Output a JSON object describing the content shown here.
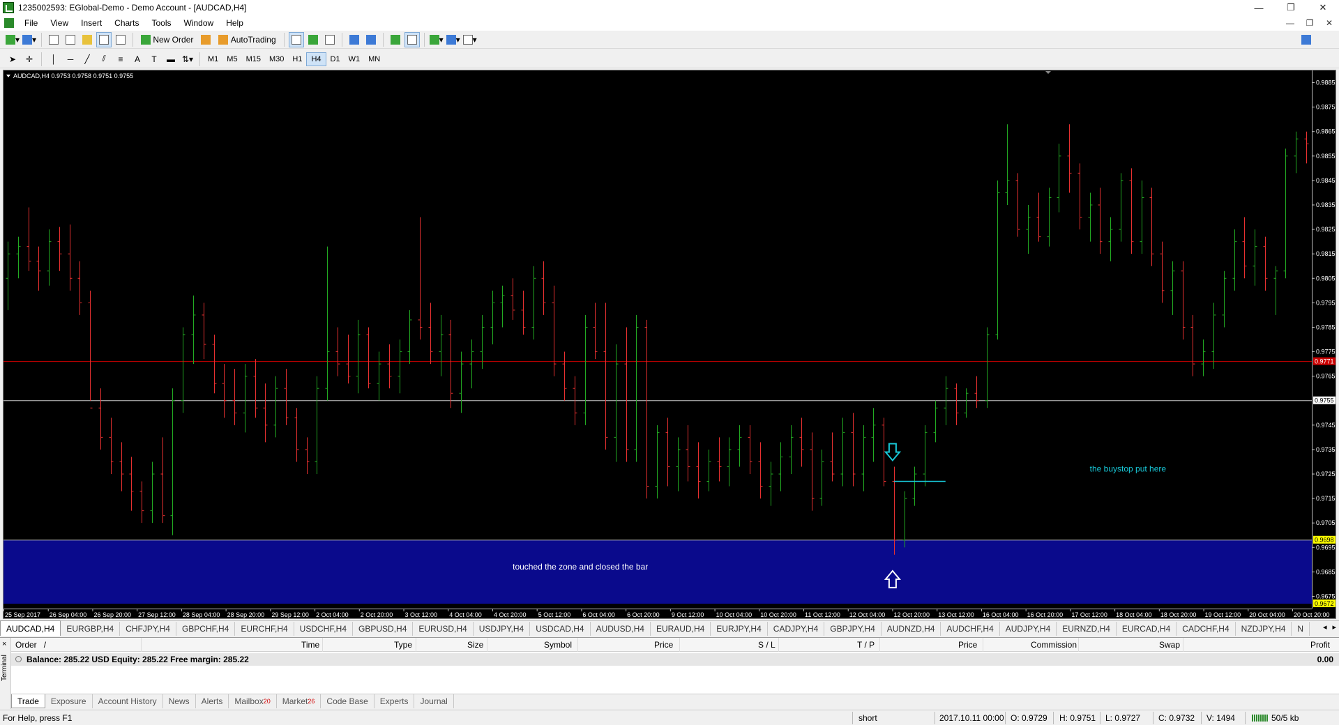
{
  "window": {
    "title": "1235002593: EGlobal-Demo - Demo Account - [AUDCAD,H4]",
    "controls": [
      "—",
      "❐",
      "✕"
    ]
  },
  "menu": {
    "items": [
      "File",
      "View",
      "Insert",
      "Charts",
      "Tools",
      "Window",
      "Help"
    ],
    "right_controls": [
      "—",
      "❐",
      "✕"
    ]
  },
  "toolbar": {
    "new_order_label": "New Order",
    "autotrading_label": "AutoTrading",
    "timeframes": [
      "M1",
      "M5",
      "M15",
      "M30",
      "H1",
      "H4",
      "D1",
      "W1",
      "MN"
    ],
    "active_timeframe": "H4"
  },
  "chart": {
    "info": "AUDCAD,H4  0.9753 0.9758 0.9751 0.9755",
    "colors": {
      "background": "#000000",
      "bull": "#22aa22",
      "bear": "#e83030",
      "zone": "#0a0a8c",
      "red_line": "#cc0000",
      "white_line": "#cccccc",
      "annotation": "#18c8d8"
    },
    "price_levels": {
      "red_line": 0.9771,
      "red_line_label": "0.9771",
      "bid_line": 0.9755,
      "bid_label": "0.9755",
      "zone_top": 0.9698,
      "zone_top_label": "0.9698",
      "zone_bottom": 0.9672,
      "zone_bottom_label": "0.9672"
    },
    "annotations": {
      "buystop_text": "the buystop put here",
      "zone_text": "touched the zone and closed the bar"
    }
  },
  "chart_data": {
    "type": "candlestick",
    "symbol": "AUDCAD",
    "timeframe": "H4",
    "y_ticks": [
      "0.9885",
      "0.9875",
      "0.9865",
      "0.9855",
      "0.9845",
      "0.9835",
      "0.9825",
      "0.9815",
      "0.9805",
      "0.9795",
      "0.9785",
      "0.9775",
      "0.9765",
      "0.9745",
      "0.9735",
      "0.9725",
      "0.9715",
      "0.9705",
      "0.9695",
      "0.9685",
      "0.9675"
    ],
    "ylim": [
      0.967,
      0.989
    ],
    "x_ticks": [
      "25 Sep 2017",
      "26 Sep 04:00",
      "26 Sep 20:00",
      "27 Sep 12:00",
      "28 Sep 04:00",
      "28 Sep 20:00",
      "29 Sep 12:00",
      "2 Oct 04:00",
      "2 Oct 20:00",
      "3 Oct 12:00",
      "4 Oct 04:00",
      "4 Oct 20:00",
      "5 Oct 12:00",
      "6 Oct 04:00",
      "6 Oct 20:00",
      "9 Oct 12:00",
      "10 Oct 04:00",
      "10 Oct 20:00",
      "11 Oct 12:00",
      "12 Oct 04:00",
      "12 Oct 20:00",
      "13 Oct 12:00",
      "16 Oct 04:00",
      "16 Oct 20:00",
      "17 Oct 12:00",
      "18 Oct 04:00",
      "18 Oct 20:00",
      "19 Oct 12:00",
      "20 Oct 04:00",
      "20 Oct 20:00"
    ],
    "bars": [
      [
        0.9805,
        0.982,
        0.9792,
        0.9815
      ],
      [
        0.9815,
        0.9822,
        0.9805,
        0.9818
      ],
      [
        0.9818,
        0.9834,
        0.9808,
        0.9812
      ],
      [
        0.9812,
        0.9818,
        0.98,
        0.9808
      ],
      [
        0.9808,
        0.9825,
        0.9802,
        0.982
      ],
      [
        0.982,
        0.9826,
        0.9808,
        0.9815
      ],
      [
        0.9815,
        0.9827,
        0.98,
        0.9805
      ],
      [
        0.9805,
        0.9812,
        0.979,
        0.9795
      ],
      [
        0.9795,
        0.98,
        0.9755,
        0.9752
      ],
      [
        0.9752,
        0.976,
        0.9735,
        0.974
      ],
      [
        0.974,
        0.9748,
        0.9725,
        0.973
      ],
      [
        0.973,
        0.9738,
        0.9718,
        0.9725
      ],
      [
        0.9725,
        0.9732,
        0.971,
        0.9718
      ],
      [
        0.9718,
        0.9722,
        0.9705,
        0.971
      ],
      [
        0.971,
        0.973,
        0.9705,
        0.9725
      ],
      [
        0.9725,
        0.974,
        0.9705,
        0.9708
      ],
      [
        0.9708,
        0.976,
        0.97,
        0.9755
      ],
      [
        0.9755,
        0.9785,
        0.975,
        0.9782
      ],
      [
        0.9782,
        0.9798,
        0.977,
        0.979
      ],
      [
        0.979,
        0.9795,
        0.9772,
        0.9778
      ],
      [
        0.9778,
        0.9782,
        0.9758,
        0.9762
      ],
      [
        0.9762,
        0.977,
        0.9748,
        0.9755
      ],
      [
        0.9755,
        0.9768,
        0.9745,
        0.975
      ],
      [
        0.975,
        0.977,
        0.9742,
        0.9765
      ],
      [
        0.9765,
        0.9772,
        0.9748,
        0.9752
      ],
      [
        0.9752,
        0.9762,
        0.9738,
        0.9745
      ],
      [
        0.9745,
        0.9765,
        0.974,
        0.976
      ],
      [
        0.976,
        0.9768,
        0.9745,
        0.9748
      ],
      [
        0.9748,
        0.9752,
        0.973,
        0.9735
      ],
      [
        0.9735,
        0.974,
        0.9725,
        0.973
      ],
      [
        0.973,
        0.9765,
        0.9725,
        0.976
      ],
      [
        0.976,
        0.9818,
        0.9755,
        0.9775
      ],
      [
        0.9775,
        0.9785,
        0.9765,
        0.977
      ],
      [
        0.977,
        0.9782,
        0.9762,
        0.9765
      ],
      [
        0.9765,
        0.9788,
        0.9758,
        0.9782
      ],
      [
        0.9782,
        0.9785,
        0.976,
        0.9762
      ],
      [
        0.9762,
        0.9775,
        0.9755,
        0.977
      ],
      [
        0.977,
        0.9778,
        0.976,
        0.9765
      ],
      [
        0.9765,
        0.978,
        0.9758,
        0.9775
      ],
      [
        0.9775,
        0.9792,
        0.977,
        0.9788
      ],
      [
        0.9788,
        0.983,
        0.978,
        0.9785
      ],
      [
        0.9785,
        0.9795,
        0.977,
        0.9775
      ],
      [
        0.9775,
        0.979,
        0.9765,
        0.9782
      ],
      [
        0.9782,
        0.9788,
        0.9752,
        0.9758
      ],
      [
        0.9758,
        0.9775,
        0.975,
        0.977
      ],
      [
        0.977,
        0.978,
        0.976,
        0.9775
      ],
      [
        0.9775,
        0.979,
        0.9768,
        0.9785
      ],
      [
        0.9785,
        0.98,
        0.9778,
        0.9795
      ],
      [
        0.9795,
        0.9802,
        0.9785,
        0.9798
      ],
      [
        0.9798,
        0.9805,
        0.9788,
        0.9792
      ],
      [
        0.9792,
        0.98,
        0.9782,
        0.9785
      ],
      [
        0.9785,
        0.981,
        0.978,
        0.9805
      ],
      [
        0.9805,
        0.9812,
        0.979,
        0.9795
      ],
      [
        0.9795,
        0.9802,
        0.9765,
        0.977
      ],
      [
        0.977,
        0.9775,
        0.9755,
        0.976
      ],
      [
        0.976,
        0.9765,
        0.9745,
        0.975
      ],
      [
        0.975,
        0.979,
        0.9745,
        0.9785
      ],
      [
        0.9785,
        0.9795,
        0.9772,
        0.9775
      ],
      [
        0.9775,
        0.9795,
        0.9735,
        0.974
      ],
      [
        0.974,
        0.9778,
        0.973,
        0.977
      ],
      [
        0.977,
        0.9785,
        0.973,
        0.9735
      ],
      [
        0.9735,
        0.979,
        0.973,
        0.9785
      ],
      [
        0.9785,
        0.9788,
        0.9715,
        0.972
      ],
      [
        0.972,
        0.9745,
        0.9715,
        0.9742
      ],
      [
        0.9742,
        0.9748,
        0.972,
        0.9728
      ],
      [
        0.9728,
        0.974,
        0.9718,
        0.9735
      ],
      [
        0.9735,
        0.9745,
        0.9722,
        0.9728
      ],
      [
        0.9728,
        0.9738,
        0.9715,
        0.9722
      ],
      [
        0.9722,
        0.9735,
        0.9718,
        0.973
      ],
      [
        0.973,
        0.974,
        0.9722,
        0.9728
      ],
      [
        0.9728,
        0.974,
        0.972,
        0.9735
      ],
      [
        0.9735,
        0.9745,
        0.9728,
        0.974
      ],
      [
        0.974,
        0.9745,
        0.9725,
        0.973
      ],
      [
        0.973,
        0.9738,
        0.9715,
        0.972
      ],
      [
        0.972,
        0.973,
        0.9712,
        0.9725
      ],
      [
        0.9725,
        0.9738,
        0.9718,
        0.9732
      ],
      [
        0.9732,
        0.9745,
        0.9725,
        0.974
      ],
      [
        0.974,
        0.9748,
        0.9728,
        0.9735
      ],
      [
        0.9735,
        0.9742,
        0.971,
        0.9715
      ],
      [
        0.9715,
        0.9735,
        0.9712,
        0.973
      ],
      [
        0.973,
        0.9742,
        0.9722,
        0.9725
      ],
      [
        0.9725,
        0.9748,
        0.972,
        0.9742
      ],
      [
        0.9742,
        0.975,
        0.972,
        0.9725
      ],
      [
        0.9725,
        0.9745,
        0.9718,
        0.974
      ],
      [
        0.974,
        0.9752,
        0.973,
        0.9745
      ],
      [
        0.9745,
        0.9748,
        0.972,
        0.9722
      ],
      [
        0.9722,
        0.9728,
        0.9692,
        0.9698
      ],
      [
        0.9698,
        0.9718,
        0.9695,
        0.9715
      ],
      [
        0.9715,
        0.9728,
        0.9712,
        0.9725
      ],
      [
        0.9725,
        0.9745,
        0.972,
        0.9742
      ],
      [
        0.9742,
        0.9755,
        0.9738,
        0.9752
      ],
      [
        0.9752,
        0.9765,
        0.9745,
        0.976
      ],
      [
        0.976,
        0.9762,
        0.9745,
        0.975
      ],
      [
        0.975,
        0.976,
        0.9748,
        0.9758
      ],
      [
        0.9758,
        0.9765,
        0.9752,
        0.9755
      ],
      [
        0.9755,
        0.9785,
        0.9752,
        0.9782
      ],
      [
        0.9782,
        0.9845,
        0.978,
        0.984
      ],
      [
        0.984,
        0.9868,
        0.9835,
        0.9845
      ],
      [
        0.9845,
        0.9848,
        0.9822,
        0.9825
      ],
      [
        0.9825,
        0.9835,
        0.9815,
        0.983
      ],
      [
        0.983,
        0.984,
        0.982,
        0.9822
      ],
      [
        0.9822,
        0.9842,
        0.9818,
        0.9838
      ],
      [
        0.9838,
        0.986,
        0.9832,
        0.9855
      ],
      [
        0.9855,
        0.9868,
        0.984,
        0.9848
      ],
      [
        0.9848,
        0.9852,
        0.9825,
        0.983
      ],
      [
        0.983,
        0.984,
        0.982,
        0.9835
      ],
      [
        0.9835,
        0.9842,
        0.9815,
        0.982
      ],
      [
        0.982,
        0.983,
        0.9812,
        0.9825
      ],
      [
        0.9825,
        0.9848,
        0.982,
        0.9845
      ],
      [
        0.9845,
        0.985,
        0.9815,
        0.982
      ],
      [
        0.982,
        0.9845,
        0.9815,
        0.9838
      ],
      [
        0.9838,
        0.9842,
        0.981,
        0.9815
      ],
      [
        0.9815,
        0.982,
        0.9795,
        0.98
      ],
      [
        0.98,
        0.9812,
        0.979,
        0.9808
      ],
      [
        0.9808,
        0.9812,
        0.978,
        0.9785
      ],
      [
        0.9785,
        0.979,
        0.9765,
        0.977
      ],
      [
        0.977,
        0.978,
        0.9765,
        0.9775
      ],
      [
        0.9775,
        0.9795,
        0.9768,
        0.979
      ],
      [
        0.979,
        0.9808,
        0.9785,
        0.9805
      ],
      [
        0.9805,
        0.9825,
        0.98,
        0.982
      ],
      [
        0.982,
        0.983,
        0.9805,
        0.981
      ],
      [
        0.981,
        0.9825,
        0.9802,
        0.9818
      ],
      [
        0.9818,
        0.9822,
        0.98,
        0.9805
      ],
      [
        0.9805,
        0.981,
        0.979,
        0.9808
      ],
      [
        0.9808,
        0.9858,
        0.9805,
        0.9855
      ],
      [
        0.9855,
        0.9865,
        0.9848,
        0.9862
      ],
      [
        0.9862,
        0.9865,
        0.9852,
        0.986
      ]
    ],
    "buystop_level": 0.9722,
    "down_arrow_price": 0.973,
    "up_arrow_price": 0.9682,
    "grid": false
  },
  "symbol_tabs": {
    "items": [
      "AUDCAD,H4",
      "EURGBP,H4",
      "CHFJPY,H4",
      "GBPCHF,H4",
      "EURCHF,H4",
      "USDCHF,H4",
      "GBPUSD,H4",
      "EURUSD,H4",
      "USDJPY,H4",
      "USDCAD,H4",
      "AUDUSD,H4",
      "EURAUD,H4",
      "EURJPY,H4",
      "CADJPY,H4",
      "GBPJPY,H4",
      "AUDNZD,H4",
      "AUDCHF,H4",
      "AUDJPY,H4",
      "EURNZD,H4",
      "EURCAD,H4",
      "CADCHF,H4",
      "NZDJPY,H4",
      "N"
    ],
    "nav": [
      "◂",
      "▸"
    ]
  },
  "terminal": {
    "side_label": "Terminal",
    "close": "×",
    "headers": {
      "order": "Order",
      "order_sort": "/",
      "time": "Time",
      "type": "Type",
      "size": "Size",
      "symbol": "Symbol",
      "price": "Price",
      "sl": "S / L",
      "tp": "T / P",
      "price2": "Price",
      "commission": "Commission",
      "swap": "Swap",
      "profit": "Profit"
    },
    "balance_line": "Balance: 285.22 USD  Equity: 285.22  Free margin: 285.22",
    "profit_value": "0.00",
    "tabs": [
      {
        "label": "Trade",
        "badge": ""
      },
      {
        "label": "Exposure",
        "badge": ""
      },
      {
        "label": "Account History",
        "badge": ""
      },
      {
        "label": "News",
        "badge": ""
      },
      {
        "label": "Alerts",
        "badge": ""
      },
      {
        "label": "Mailbox",
        "badge": "20"
      },
      {
        "label": "Market",
        "badge": "26"
      },
      {
        "label": "Code Base",
        "badge": ""
      },
      {
        "label": "Experts",
        "badge": ""
      },
      {
        "label": "Journal",
        "badge": ""
      }
    ]
  },
  "status": {
    "help": "For Help, press F1",
    "profile": "short",
    "datetime": "2017.10.11 00:00",
    "open": "O: 0.9729",
    "high": "H: 0.9751",
    "low": "L: 0.9727",
    "close": "C: 0.9732",
    "volume": "V: 1494",
    "traffic": "50/5 kb"
  }
}
